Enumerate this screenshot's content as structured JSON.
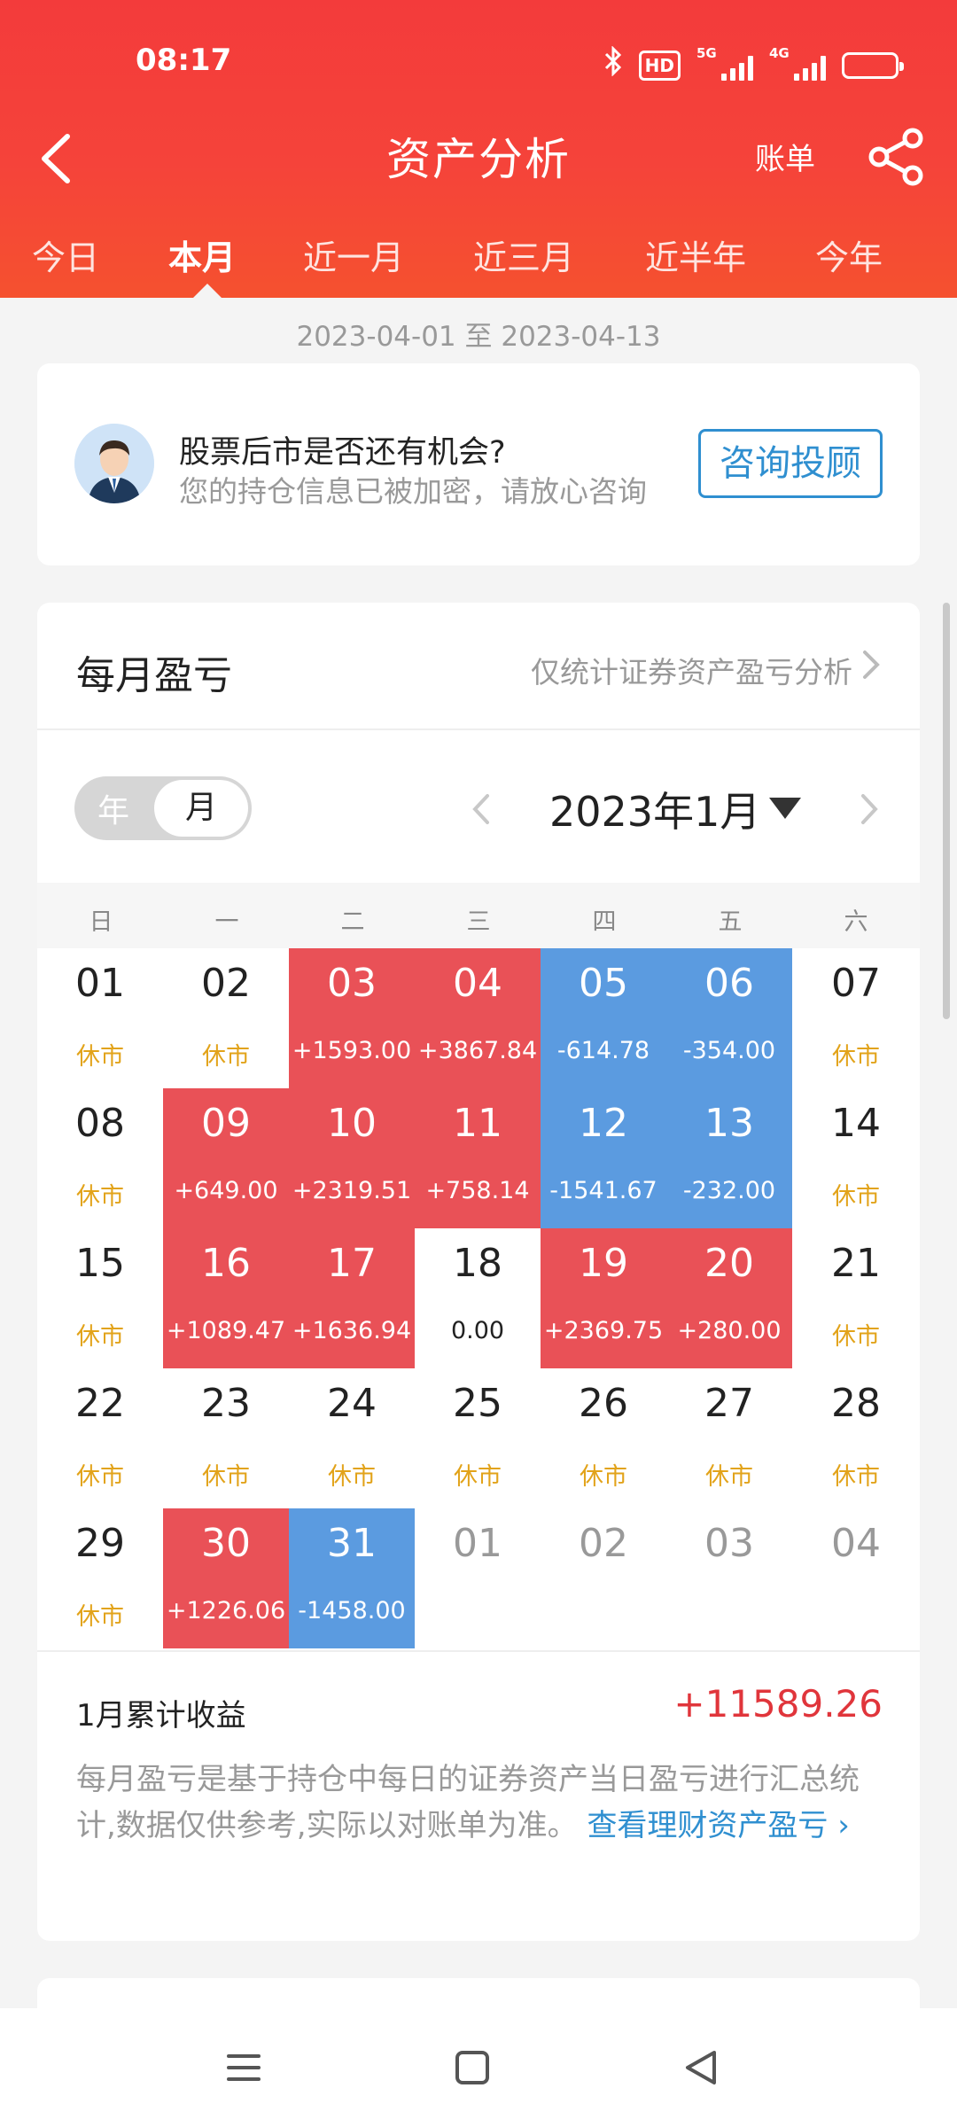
{
  "status_bar": {
    "time": "08:17",
    "hd_label": "HD",
    "signal1_label": "5G",
    "signal2_label": "4G"
  },
  "nav": {
    "title": "资产分析",
    "bill_label": "账单"
  },
  "tabs": [
    "今日",
    "本月",
    "近一月",
    "近三月",
    "近半年",
    "今年"
  ],
  "active_tab": "本月",
  "date_range": "2023-04-01 至 2023-04-13",
  "advisor": {
    "title": "股票后市是否还有机会?",
    "subtitle": "您的持仓信息已被加密，请放心咨询",
    "button_label": "咨询投顾"
  },
  "monthly_pl": {
    "title": "每月盈亏",
    "link_text": "仅统计证券资产盈亏分析",
    "toggle_year": "年",
    "toggle_month": "月",
    "month_label": "2023年1月",
    "weekdays": [
      "日",
      "一",
      "二",
      "三",
      "四",
      "五",
      "六"
    ],
    "days": [
      {
        "day": "01",
        "value": "休市",
        "type": "closed"
      },
      {
        "day": "02",
        "value": "休市",
        "type": "closed"
      },
      {
        "day": "03",
        "value": "+1593.00",
        "type": "gain"
      },
      {
        "day": "04",
        "value": "+3867.84",
        "type": "gain"
      },
      {
        "day": "05",
        "value": "-614.78",
        "type": "loss"
      },
      {
        "day": "06",
        "value": "-354.00",
        "type": "loss"
      },
      {
        "day": "07",
        "value": "休市",
        "type": "closed"
      },
      {
        "day": "08",
        "value": "休市",
        "type": "closed"
      },
      {
        "day": "09",
        "value": "+649.00",
        "type": "gain"
      },
      {
        "day": "10",
        "value": "+2319.51",
        "type": "gain"
      },
      {
        "day": "11",
        "value": "+758.14",
        "type": "gain"
      },
      {
        "day": "12",
        "value": "-1541.67",
        "type": "loss"
      },
      {
        "day": "13",
        "value": "-232.00",
        "type": "loss"
      },
      {
        "day": "14",
        "value": "休市",
        "type": "closed"
      },
      {
        "day": "15",
        "value": "休市",
        "type": "closed"
      },
      {
        "day": "16",
        "value": "+1089.47",
        "type": "gain"
      },
      {
        "day": "17",
        "value": "+1636.94",
        "type": "gain"
      },
      {
        "day": "18",
        "value": "0.00",
        "type": "flat"
      },
      {
        "day": "19",
        "value": "+2369.75",
        "type": "gain"
      },
      {
        "day": "20",
        "value": "+280.00",
        "type": "gain"
      },
      {
        "day": "21",
        "value": "休市",
        "type": "closed"
      },
      {
        "day": "22",
        "value": "休市",
        "type": "closed"
      },
      {
        "day": "23",
        "value": "休市",
        "type": "closed"
      },
      {
        "day": "24",
        "value": "休市",
        "type": "closed"
      },
      {
        "day": "25",
        "value": "休市",
        "type": "closed"
      },
      {
        "day": "26",
        "value": "休市",
        "type": "closed"
      },
      {
        "day": "27",
        "value": "休市",
        "type": "closed"
      },
      {
        "day": "28",
        "value": "休市",
        "type": "closed"
      },
      {
        "day": "29",
        "value": "休市",
        "type": "closed"
      },
      {
        "day": "30",
        "value": "+1226.06",
        "type": "gain"
      },
      {
        "day": "31",
        "value": "-1458.00",
        "type": "loss"
      },
      {
        "day": "01",
        "value": "",
        "type": "other"
      },
      {
        "day": "02",
        "value": "",
        "type": "other"
      },
      {
        "day": "03",
        "value": "",
        "type": "other"
      },
      {
        "day": "04",
        "value": "",
        "type": "other"
      }
    ],
    "summary_label": "1月累计收益",
    "summary_value": "+11589.26",
    "note_text": "每月盈亏是基于持仓中每日的证券资产当日盈亏进行汇总统计,数据仅供参考,实际以对账单为准。",
    "note_link": "查看理财资产盈亏 ›"
  },
  "colors": {
    "header_red": "#f33b3b",
    "gain_red": "#e95157",
    "loss_blue": "#5b9be0",
    "closed_orange": "#e2a31a",
    "link_blue": "#2f8fd0",
    "summary_red": "#e0353b"
  },
  "icons": {
    "back": "back-arrow-icon",
    "share": "share-icon",
    "bluetooth": "bluetooth-icon",
    "battery": "battery-icon",
    "prev_month": "chevron-left-icon",
    "next_month": "chevron-right-icon",
    "dropdown": "triangle-down-icon",
    "nav_menu": "menu-icon",
    "nav_home": "home-square-icon",
    "nav_back": "triangle-back-icon"
  }
}
